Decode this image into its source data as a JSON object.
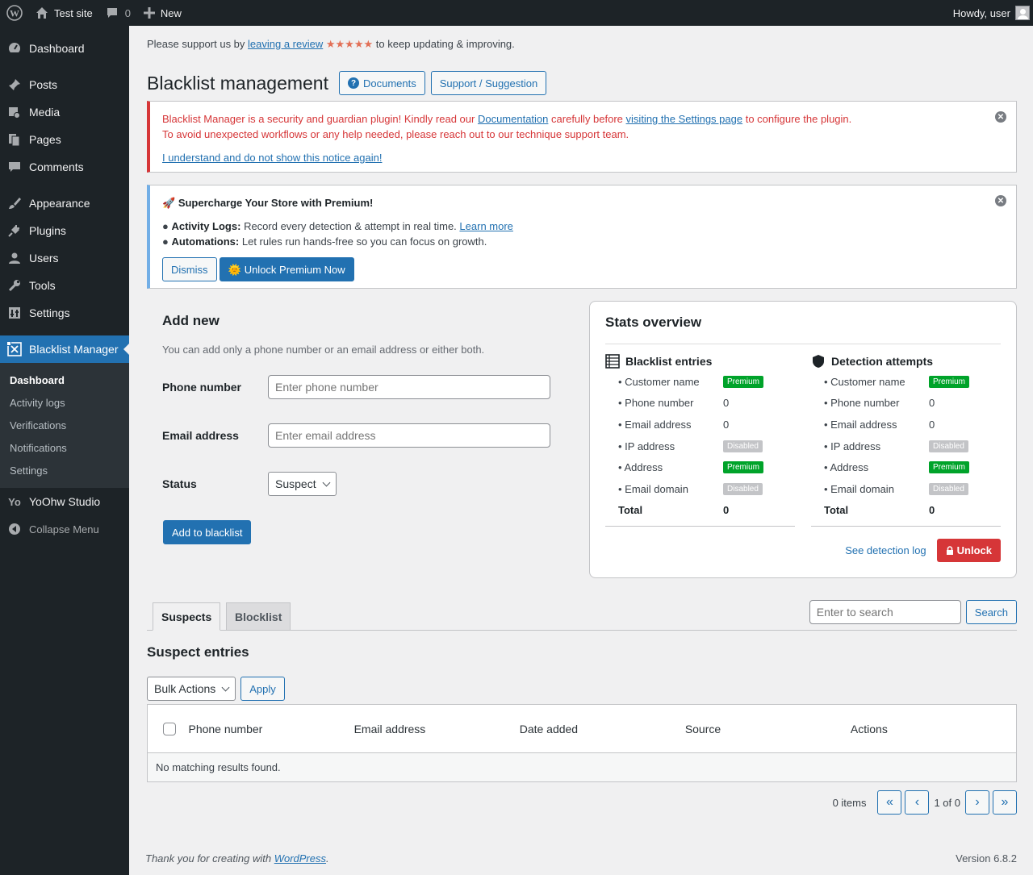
{
  "adminbar": {
    "site_name": "Test site",
    "comments_count": "0",
    "new_label": "New",
    "howdy": "Howdy, user"
  },
  "sidebar": {
    "items": [
      {
        "label": "Dashboard",
        "icon": "dashboard-icon"
      },
      {
        "label": "Posts",
        "icon": "pin-icon"
      },
      {
        "label": "Media",
        "icon": "media-icon"
      },
      {
        "label": "Pages",
        "icon": "pages-icon"
      },
      {
        "label": "Comments",
        "icon": "comment-icon"
      },
      {
        "label": "Appearance",
        "icon": "brush-icon"
      },
      {
        "label": "Plugins",
        "icon": "plug-icon"
      },
      {
        "label": "Users",
        "icon": "user-icon"
      },
      {
        "label": "Tools",
        "icon": "wrench-icon"
      },
      {
        "label": "Settings",
        "icon": "settings-icon"
      },
      {
        "label": "Blacklist Manager",
        "icon": "blacklist-icon"
      },
      {
        "label": "YoOhw Studio",
        "icon": "yo-icon"
      },
      {
        "label": "Collapse Menu",
        "icon": "collapse-icon"
      }
    ],
    "submenu": [
      "Dashboard",
      "Activity logs",
      "Verifications",
      "Notifications",
      "Settings"
    ]
  },
  "support": {
    "prefix": "Please support us by",
    "link": "leaving a review",
    "stars": "★★★★★",
    "suffix": "to keep updating & improving."
  },
  "page": {
    "title": "Blacklist management",
    "documents_button": "Documents",
    "support_button": "Support / Suggestion"
  },
  "notice_error": {
    "t1": "Blacklist Manager is a security and guardian plugin! Kindly read our",
    "doc_link": "Documentation",
    "t2": "carefully before",
    "settings_link": "visiting the Settings page",
    "t3": "to configure the plugin.",
    "line2": "To avoid unexpected workflows or any help needed, please reach out to our technique support team.",
    "dismiss_link": "I understand and do not show this notice again!"
  },
  "notice_premium": {
    "title": "Supercharge Your Store with Premium!",
    "f1_label": "Activity Logs:",
    "f1_text": "Record every detection & attempt in real time.",
    "f1_link": "Learn more",
    "f2_label": "Automations:",
    "f2_text": "Let rules run hands-free so you can focus on growth.",
    "dismiss": "Dismiss",
    "unlock": "Unlock Premium Now"
  },
  "add_new": {
    "title": "Add new",
    "description": "You can add only a phone number or an email address or either both.",
    "phone_label": "Phone number",
    "phone_placeholder": "Enter phone number",
    "email_label": "Email address",
    "email_placeholder": "Enter email address",
    "status_label": "Status",
    "status_value": "Suspect",
    "submit": "Add to blacklist"
  },
  "stats": {
    "title": "Stats overview",
    "blacklist": {
      "title": "Blacklist entries",
      "rows": [
        {
          "k": "• Customer name",
          "v": "Premium",
          "type": "premium"
        },
        {
          "k": "• Phone number",
          "v": "0",
          "type": "text"
        },
        {
          "k": "• Email address",
          "v": "0",
          "type": "text"
        },
        {
          "k": "• IP address",
          "v": "Disabled",
          "type": "disabled"
        },
        {
          "k": "• Address",
          "v": "Premium",
          "type": "premium"
        },
        {
          "k": "• Email domain",
          "v": "Disabled",
          "type": "disabled"
        }
      ],
      "total_label": "Total",
      "total_value": "0"
    },
    "detection": {
      "title": "Detection attempts",
      "rows": [
        {
          "k": "• Customer name",
          "v": "Premium",
          "type": "premium"
        },
        {
          "k": "• Phone number",
          "v": "0",
          "type": "text"
        },
        {
          "k": "• Email address",
          "v": "0",
          "type": "text"
        },
        {
          "k": "• IP address",
          "v": "Disabled",
          "type": "disabled"
        },
        {
          "k": "• Address",
          "v": "Premium",
          "type": "premium"
        },
        {
          "k": "• Email domain",
          "v": "Disabled",
          "type": "disabled"
        }
      ],
      "total_label": "Total",
      "total_value": "0"
    },
    "see_log": "See detection log",
    "unlock": "Unlock"
  },
  "tabs": {
    "suspects": "Suspects",
    "blocklist": "Blocklist"
  },
  "search": {
    "placeholder": "Enter to search",
    "button": "Search"
  },
  "entries": {
    "title": "Suspect entries",
    "bulk_actions": "Bulk Actions",
    "apply": "Apply",
    "columns": [
      "Phone number",
      "Email address",
      "Date added",
      "Source",
      "Actions"
    ],
    "empty": "No matching results found."
  },
  "pagination": {
    "count": "0 items",
    "first": "«",
    "prev": "‹",
    "current": "1 of 0",
    "next": "›",
    "last": "»"
  },
  "footer": {
    "thanks_prefix": "Thank you for creating with",
    "wp_link": "WordPress",
    "thanks_suffix": ".",
    "version": "Version 6.8.2"
  },
  "colors": {
    "accent": "#2271b1",
    "error": "#d63638",
    "premium": "#00a32a",
    "sidebar": "#1d2327"
  }
}
